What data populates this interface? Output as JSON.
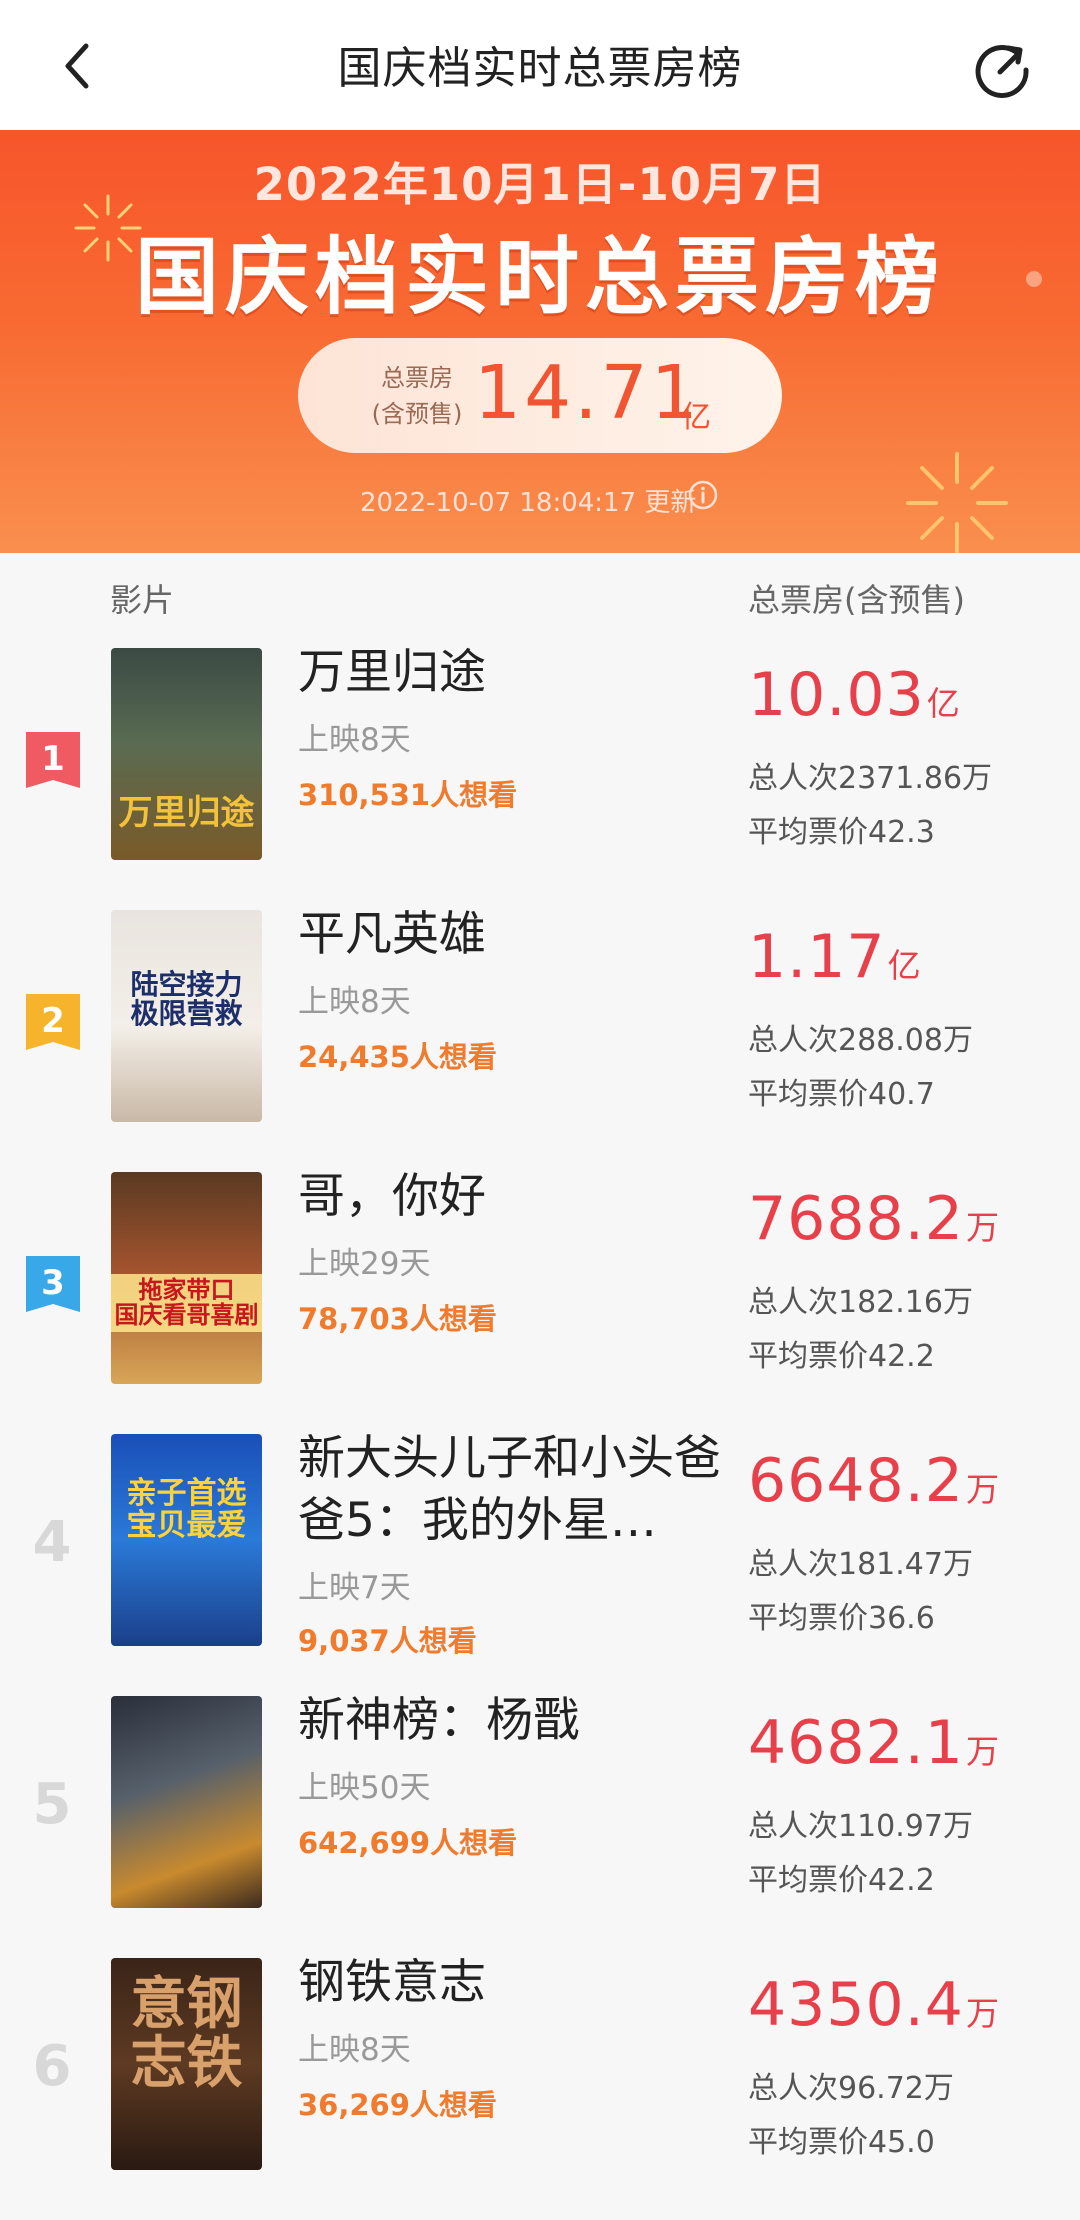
{
  "nav": {
    "title": "国庆档实时总票房榜",
    "back_icon": "chevron-left-icon",
    "refresh_icon": "refresh-icon"
  },
  "banner": {
    "date_range": "2022年10月1日-10月7日",
    "title": "国庆档实时总票房榜",
    "total_label_line1": "总票房",
    "total_label_line2": "(含预售)",
    "total_value": "14.71",
    "total_unit": "亿",
    "updated": "2022-10-07 18:04:17 更新",
    "colors": {
      "accent": "#f25431",
      "banner": "#f7552b"
    }
  },
  "list": {
    "header_film": "影片",
    "header_box": "总票房(含预售)",
    "movies": [
      {
        "rank": "1",
        "title": "万里归途",
        "days": "上映8天",
        "want": "310,531人想看",
        "box": "10.03",
        "box_unit": "亿",
        "people": "总人次2371.86万",
        "price": "平均票价42.3",
        "poster_text": "万里归途"
      },
      {
        "rank": "2",
        "title": "平凡英雄",
        "days": "上映8天",
        "want": "24,435人想看",
        "box": "1.17",
        "box_unit": "亿",
        "people": "总人次288.08万",
        "price": "平均票价40.7",
        "poster_text": "陆空接力\n极限营救"
      },
      {
        "rank": "3",
        "title": "哥，你好",
        "days": "上映29天",
        "want": "78,703人想看",
        "box": "7688.2",
        "box_unit": "万",
        "people": "总人次182.16万",
        "price": "平均票价42.2",
        "poster_text": "拖家带口\n国庆看哥喜剧"
      },
      {
        "rank": "4",
        "title": "新大头儿子和小头爸爸5：我的外星…",
        "days": "上映7天",
        "want": "9,037人想看",
        "box": "6648.2",
        "box_unit": "万",
        "people": "总人次181.47万",
        "price": "平均票价36.6",
        "poster_text": "亲子首选\n宝贝最爱"
      },
      {
        "rank": "5",
        "title": "新神榜：杨戬",
        "days": "上映50天",
        "want": "642,699人想看",
        "box": "4682.1",
        "box_unit": "万",
        "people": "总人次110.97万",
        "price": "平均票价42.2",
        "poster_text": ""
      },
      {
        "rank": "6",
        "title": "钢铁意志",
        "days": "上映8天",
        "want": "36,269人想看",
        "box": "4350.4",
        "box_unit": "万",
        "people": "总人次96.72万",
        "price": "平均票价45.0",
        "poster_text": "意钢\n志铁"
      }
    ],
    "rank_colors": {
      "1": "#ef5a63",
      "2": "#f5b42b",
      "3": "#39a8e8"
    }
  }
}
